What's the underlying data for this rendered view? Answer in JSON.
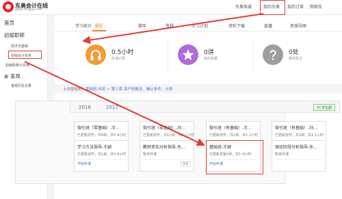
{
  "header": {
    "brand": "东奥会计在线",
    "url": "www.dongao.com",
    "nav": [
      "东奥商城",
      "我的东奥",
      "我的订单",
      "购物车"
    ]
  },
  "sidebar": {
    "home": "首页",
    "section1": "初级职称",
    "items": [
      "经济法基础",
      "初级会计实务",
      "初级职称公共课"
    ],
    "section2": "发现",
    "items2": [
      "答疑历史记录"
    ]
  },
  "tabs": [
    "学习统计",
    "课程",
    "题库",
    "答疑",
    "学习计划",
    "资料下载",
    "直播",
    "思维导图"
  ],
  "stats": [
    {
      "num": "0.5小时",
      "label": "听课记录",
      "icon": "headphones-icon",
      "color": "#f59a3a"
    },
    {
      "num": "0讲",
      "label": "我的收藏",
      "icon": "star-icon",
      "color": "#b06bd9"
    },
    {
      "num": "0处",
      "label": "我的笔记",
      "icon": "question-icon",
      "color": "#9e9e9e"
    }
  ],
  "crumb": {
    "prefix": "上次您在听：",
    "path": "基础班-刘忠 > 第三章 资产的概念、确认条件、分类"
  },
  "years": [
    "2018",
    "2017"
  ],
  "pc_badge": "PC觉拍器",
  "cards": [
    {
      "title": "指引班（零基础）-王...",
      "sub": "已更新完毕，共9讲，共5.9小时",
      "link": "已听至第1讲",
      "tag": ""
    },
    {
      "title": "指引班（零基础）-刘...",
      "sub": "已更新完毕，共11讲，共9.1小时",
      "link": "开始听课",
      "tag": ""
    },
    {
      "title": "指引班（有基础）-王...",
      "sub": "已更新完毕，共2讲，共1.1小时",
      "link": "开始听课",
      "tag": ""
    },
    {
      "title": "指引班（有基础）-刘...",
      "sub": "已更新完毕，共3讲，共2.1小时",
      "link": "开始听课",
      "tag": ""
    },
    {
      "title": "学习方法指导-王颖",
      "sub": "已更新完毕，共1讲，共0.9小时",
      "link": "开始听课",
      "tag": ""
    },
    {
      "title": "教材变化分析指导-东...",
      "sub": "暂未开课",
      "link": "",
      "tag": "独家"
    },
    {
      "title": "基础班-王颖",
      "sub": "已更新至第2讲，共1.4小时",
      "link": "开始听课",
      "tag": ""
    },
    {
      "title": "强化阶段分析指导-东...",
      "sub": "暂未开课",
      "link": "",
      "tag": ""
    }
  ]
}
